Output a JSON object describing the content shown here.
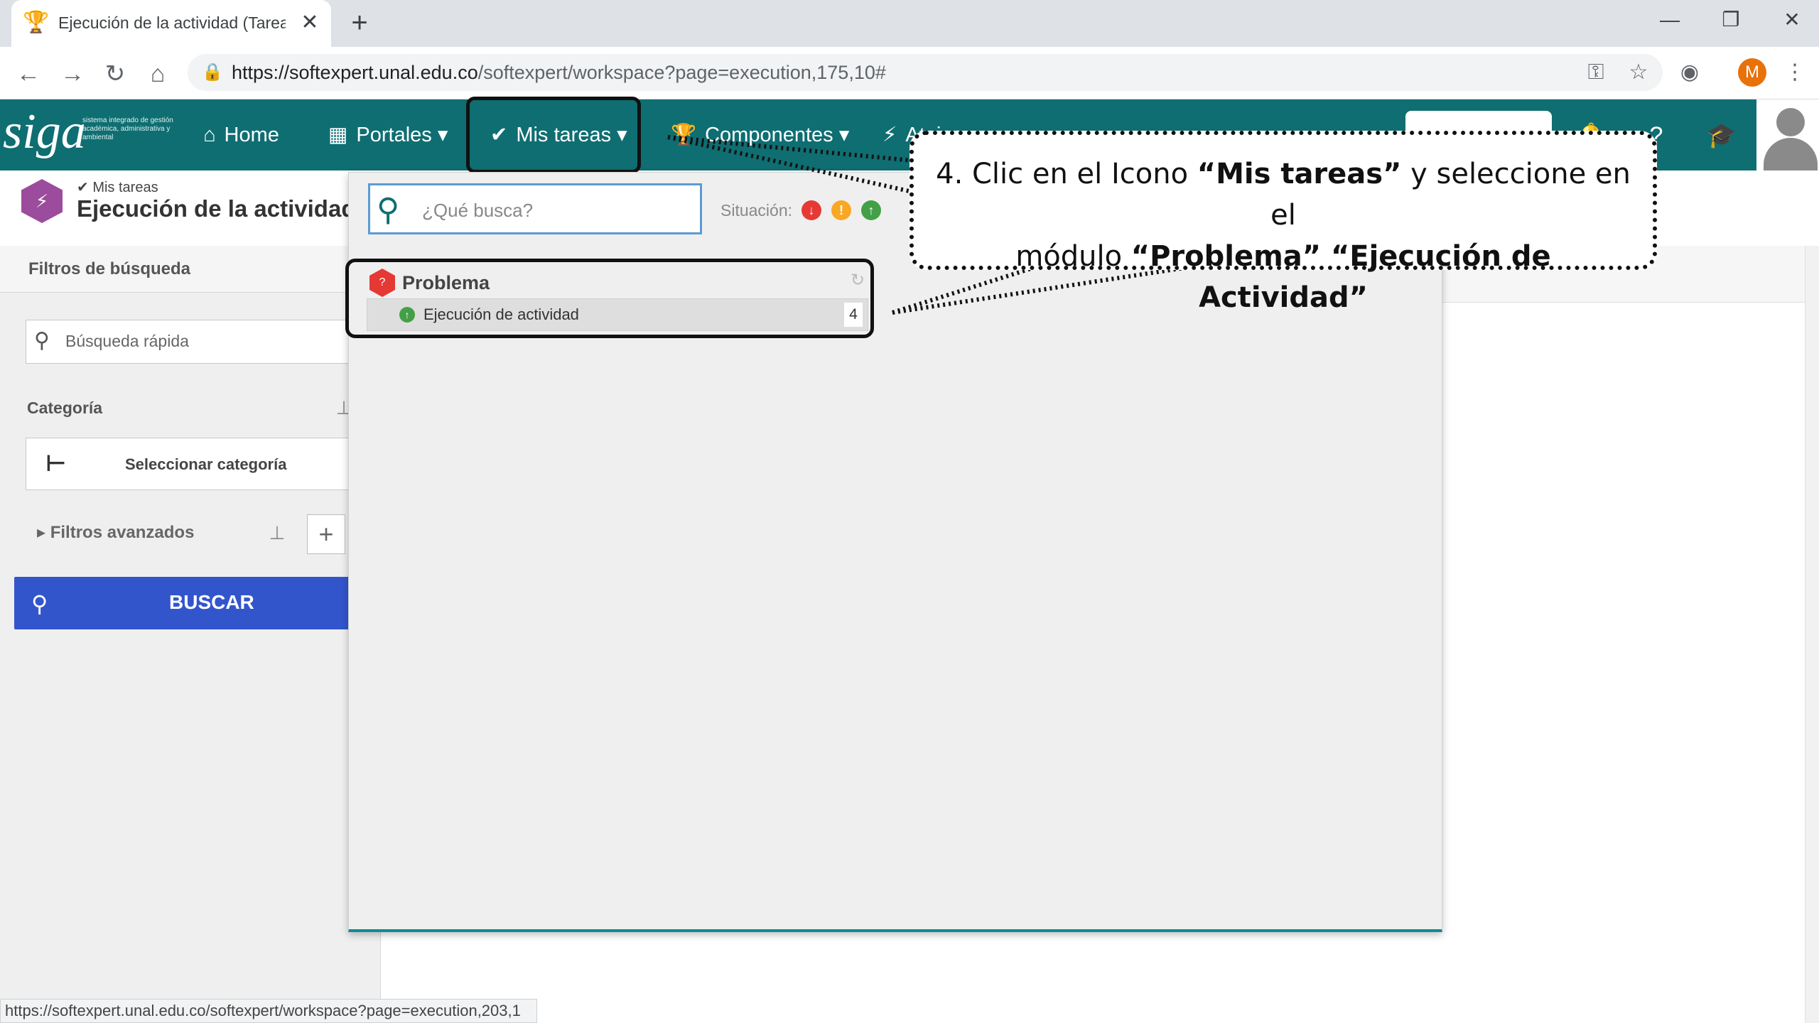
{
  "browser": {
    "tab_title": "Ejecución de la actividad (Tarea)",
    "url_host": "https://softexpert.unal.edu.co",
    "url_path": "/softexpert/workspace?page=execution,175,10#",
    "profile_initial": "M",
    "status_url": "https://softexpert.unal.edu.co/softexpert/workspace?page=execution,203,1"
  },
  "app": {
    "logo_text": "siga",
    "logo_subtitle": "sistema integrado de gestión académica, administrativa y ambiental",
    "menu": {
      "home": "Home",
      "portales": "Portales",
      "mis_tareas": "Mis tareas",
      "componentes": "Componentes",
      "atajos": "Atajos"
    }
  },
  "page": {
    "breadcrumb": "Mis tareas",
    "title": "Ejecución de la actividad"
  },
  "filters": {
    "title": "Filtros de búsqueda",
    "quick_search_placeholder": "Búsqueda rápida",
    "category_label": "Categoría",
    "category_button": "Seleccionar categoría",
    "advanced": "Filtros avanzados",
    "search_button": "BUSCAR"
  },
  "dropdown": {
    "search_placeholder": "¿Qué busca?",
    "situation_label": "Situación:",
    "group": {
      "title": "Problema",
      "task_label": "Ejecución de actividad",
      "task_count": "4"
    }
  },
  "callout": {
    "line1_prefix": "4. Clic en el Icono ",
    "line1_bold": "“Mis tareas”",
    "line1_suffix": " y seleccione en el",
    "line2_prefix": "módulo ",
    "line2_bold": "“Problema” “Ejecución de Actividad”"
  },
  "colors": {
    "appbar": "#0f6e72",
    "search_button": "#3355cc",
    "situation_red": "#e53935",
    "situation_yellow": "#f9a825",
    "situation_green": "#43a047"
  }
}
